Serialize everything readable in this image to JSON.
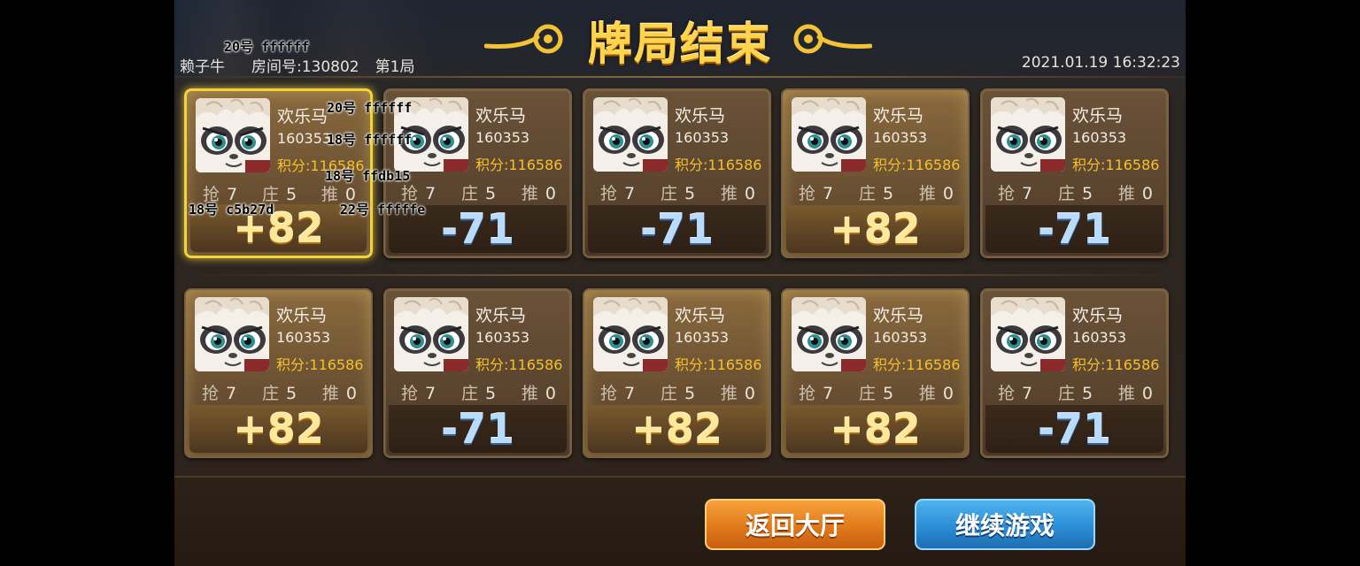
{
  "header": {
    "title": "牌局结束",
    "game_name": "赖子牛",
    "room": "房间号:130802",
    "round": "第1局",
    "datetime": "2021.01.19  16:32:23"
  },
  "debug_labels": [
    "20号 ffffff",
    "20号 ffffff",
    "18号 ffffff",
    "18号 ffdb15",
    "18号 c5b27d",
    "22号 fffffe"
  ],
  "players": [
    {
      "name": "欢乐马",
      "id": "160353",
      "score": "积分:116586",
      "qiang_label": "抢",
      "qiang": "7",
      "zhuang_label": "庄",
      "zhuang": "5",
      "tui_label": "推",
      "tui": "0",
      "result": "+82"
    },
    {
      "name": "欢乐马",
      "id": "160353",
      "score": "积分:116586",
      "qiang_label": "抢",
      "qiang": "7",
      "zhuang_label": "庄",
      "zhuang": "5",
      "tui_label": "推",
      "tui": "0",
      "result": "-71"
    },
    {
      "name": "欢乐马",
      "id": "160353",
      "score": "积分:116586",
      "qiang_label": "抢",
      "qiang": "7",
      "zhuang_label": "庄",
      "zhuang": "5",
      "tui_label": "推",
      "tui": "0",
      "result": "-71"
    },
    {
      "name": "欢乐马",
      "id": "160353",
      "score": "积分:116586",
      "qiang_label": "抢",
      "qiang": "7",
      "zhuang_label": "庄",
      "zhuang": "5",
      "tui_label": "推",
      "tui": "0",
      "result": "+82"
    },
    {
      "name": "欢乐马",
      "id": "160353",
      "score": "积分:116586",
      "qiang_label": "抢",
      "qiang": "7",
      "zhuang_label": "庄",
      "zhuang": "5",
      "tui_label": "推",
      "tui": "0",
      "result": "-71"
    },
    {
      "name": "欢乐马",
      "id": "160353",
      "score": "积分:116586",
      "qiang_label": "抢",
      "qiang": "7",
      "zhuang_label": "庄",
      "zhuang": "5",
      "tui_label": "推",
      "tui": "0",
      "result": "+82"
    },
    {
      "name": "欢乐马",
      "id": "160353",
      "score": "积分:116586",
      "qiang_label": "抢",
      "qiang": "7",
      "zhuang_label": "庄",
      "zhuang": "5",
      "tui_label": "推",
      "tui": "0",
      "result": "-71"
    },
    {
      "name": "欢乐马",
      "id": "160353",
      "score": "积分:116586",
      "qiang_label": "抢",
      "qiang": "7",
      "zhuang_label": "庄",
      "zhuang": "5",
      "tui_label": "推",
      "tui": "0",
      "result": "+82"
    },
    {
      "name": "欢乐马",
      "id": "160353",
      "score": "积分:116586",
      "qiang_label": "抢",
      "qiang": "7",
      "zhuang_label": "庄",
      "zhuang": "5",
      "tui_label": "推",
      "tui": "0",
      "result": "+82"
    },
    {
      "name": "欢乐马",
      "id": "160353",
      "score": "积分:116586",
      "qiang_label": "抢",
      "qiang": "7",
      "zhuang_label": "庄",
      "zhuang": "5",
      "tui_label": "推",
      "tui": "0",
      "result": "-71"
    }
  ],
  "buttons": {
    "back": "返回大厅",
    "continue": "继续游戏"
  },
  "colors": {
    "title_gold": "#ffd44a",
    "win_text": "#ffe89a",
    "lose_text": "#b8dcff",
    "score_yellow": "#f5c12a",
    "btn_orange": "#e07a1a",
    "btn_blue": "#2c8ed6"
  }
}
